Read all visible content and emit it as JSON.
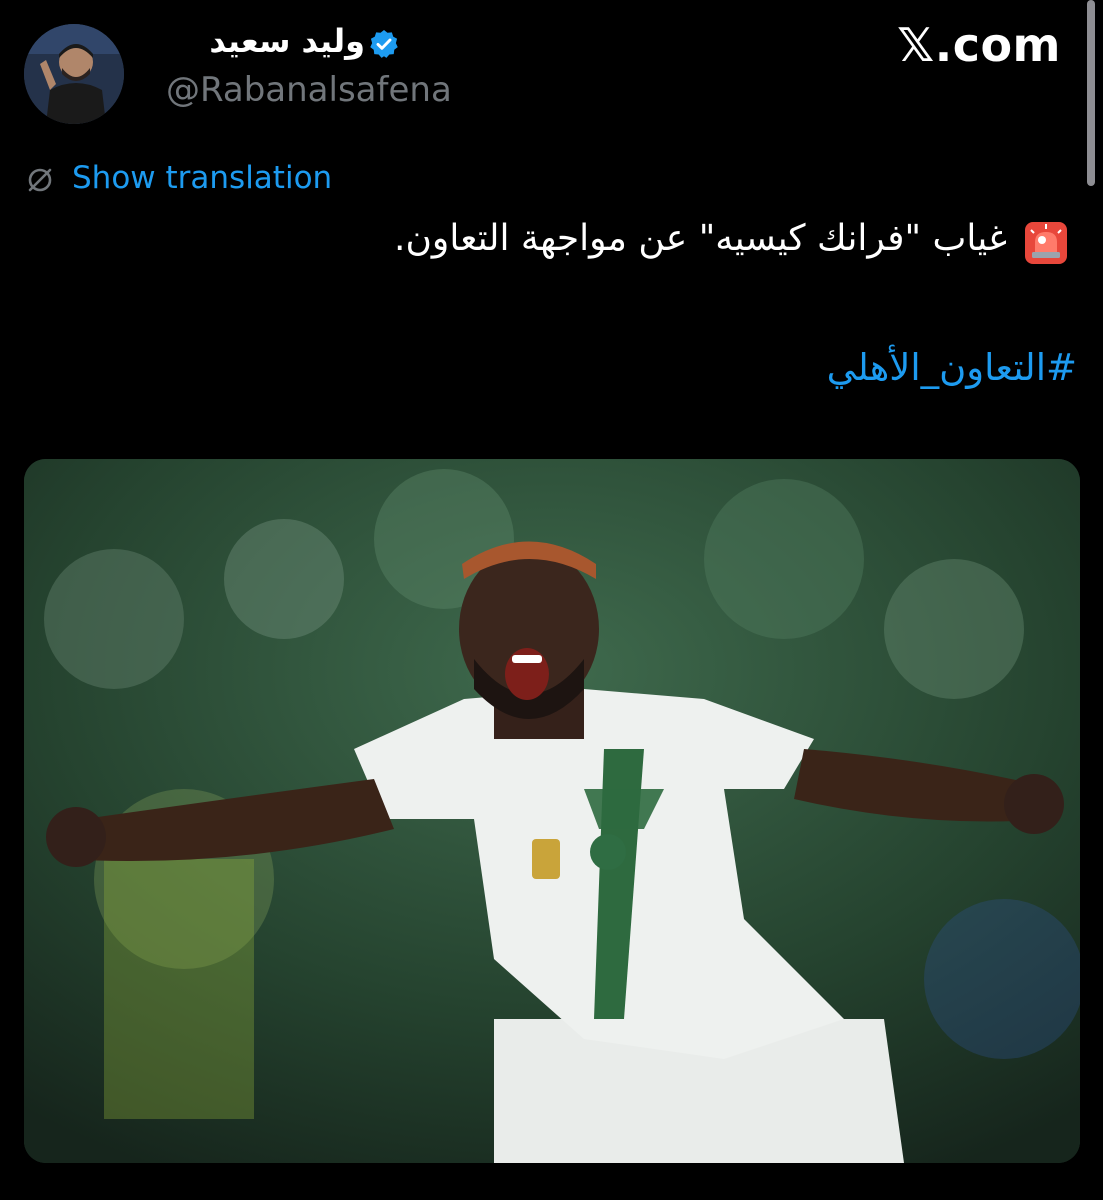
{
  "tweet": {
    "author": {
      "display_name": "وليد سعيد",
      "handle": "@Rabanalsafena",
      "verified": true
    },
    "source_site": "𝕏.com",
    "translate_link": "Show translation",
    "text": "غياب \"فرانك كيسيه\" عن مواجهة التعاون.",
    "lead_emoji": "siren-icon",
    "hashtag": "#التعاون_الأهلي",
    "media": {
      "kind": "photo",
      "subject": "football player celebrating in white and green kit"
    }
  },
  "colors": {
    "background": "#000000",
    "link": "#1d9bf0",
    "muted": "#71767b",
    "text": "#ffffff"
  }
}
